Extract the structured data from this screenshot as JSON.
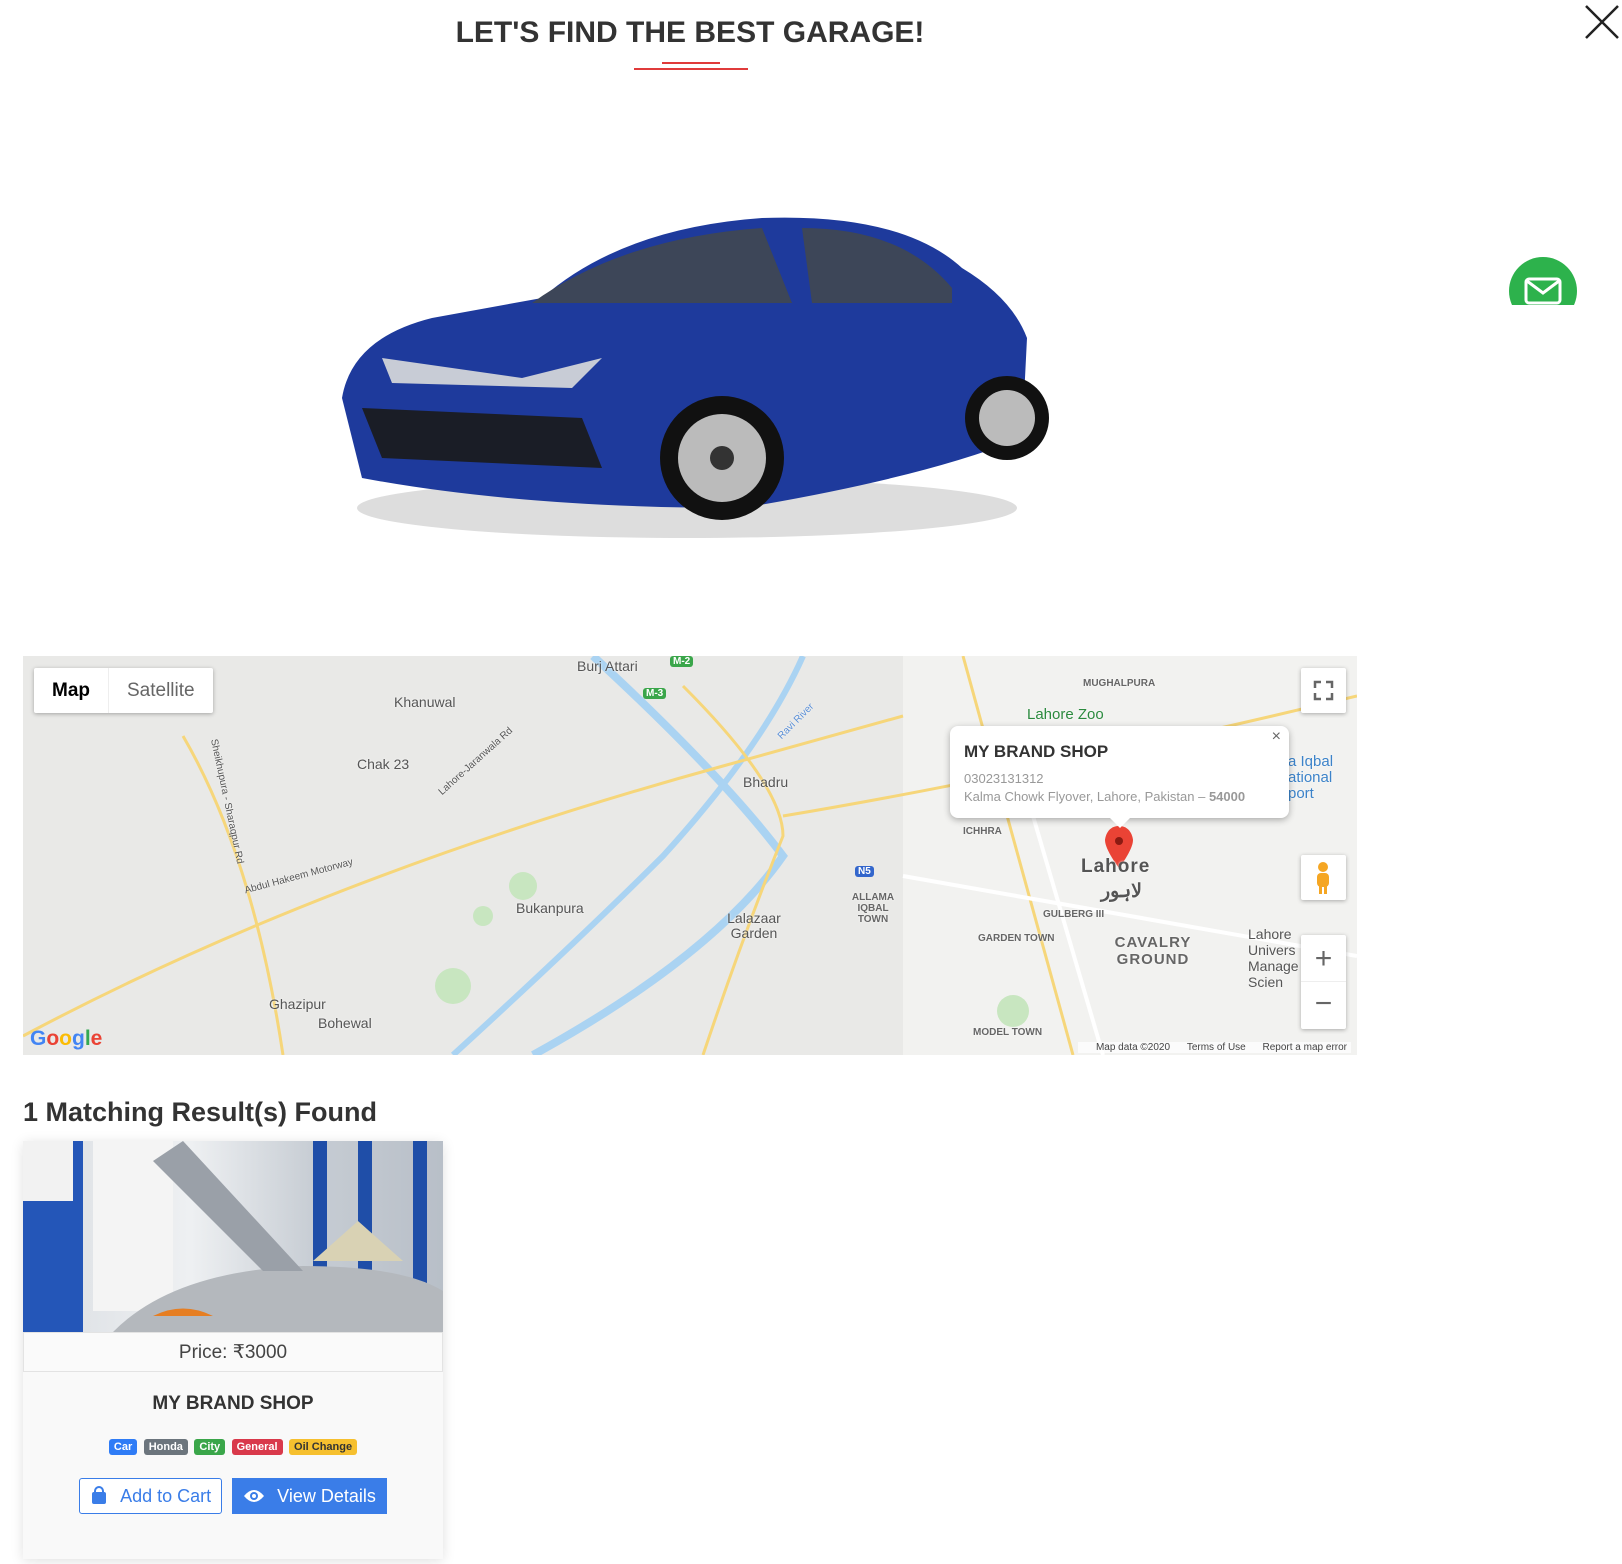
{
  "header": {
    "title": "LET'S FIND THE BEST GARAGE!"
  },
  "icons": {
    "close": "close-icon",
    "mail": "mail-icon",
    "cart": "shopping-bag-icon",
    "view": "eye-icon"
  },
  "colors": {
    "accent_red": "#e03b3b",
    "mail_green": "#2db24c",
    "primary_blue": "#3a7de8"
  },
  "map": {
    "type_buttons": [
      "Map",
      "Satellite"
    ],
    "selected_type": "Map",
    "labels": [
      "Burj Attari",
      "Khanuwal",
      "Chak 23",
      "Bhadru",
      "Bukanpura",
      "Lalazaar Garden",
      "Ghazipur",
      "Bohewal",
      "Lahore Zoo",
      "MUGHALPURA",
      "ICHHRA",
      "Lahore",
      "CAVALRY GROUND",
      "GULBERG III",
      "GARDEN TOWN",
      "ALLAMA IQBAL TOWN",
      "MODEL TOWN",
      "Lahore-Jaranwala Rd",
      "Abdul Hakeem Motorway",
      "Sheikhupura - Sharaqpur Rd",
      "M-3",
      "M-2",
      "N5",
      "Ravi River",
      "a Iqbal ational port",
      "Lahore Univers Manage Scien",
      "لاہور"
    ],
    "popup": {
      "name": "MY BRAND SHOP",
      "phone": "03023131312",
      "address": "Kalma Chowk Flyover, Lahore, Pakistan – ",
      "postcode": "54000",
      "close": "×"
    },
    "logo": "Google",
    "footer": [
      "Map data ©2020",
      "Terms of Use",
      "Report a map error"
    ],
    "zoom_in": "+",
    "zoom_out": "−"
  },
  "results": {
    "heading": "1 Matching Result(s) Found",
    "items": [
      {
        "price": "Price: ₹3000",
        "name": "MY BRAND SHOP",
        "tags": [
          {
            "label": "Car",
            "color": "#2f7cf6"
          },
          {
            "label": "Honda",
            "color": "#6c757d"
          },
          {
            "label": "City",
            "color": "#3aa64a"
          },
          {
            "label": "General",
            "color": "#d9394b"
          },
          {
            "label": "Oil Change",
            "color": "#f6c02f"
          }
        ],
        "add_to_cart": "Add to Cart",
        "view_details": "View Details"
      }
    ]
  }
}
